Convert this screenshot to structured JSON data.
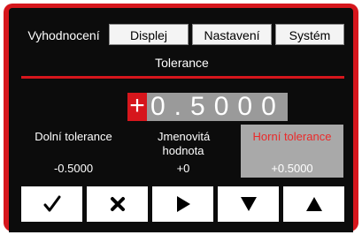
{
  "tabs": [
    {
      "label": "Vyhodnocení",
      "active": true
    },
    {
      "label": "Displej",
      "active": false
    },
    {
      "label": "Nastavení",
      "active": false
    },
    {
      "label": "Systém",
      "active": false
    }
  ],
  "section_title": "Tolerance",
  "entry": {
    "sign": "+",
    "digits": "0.5000"
  },
  "columns": {
    "lower": {
      "label": "Dolní tolerance",
      "value": "-0.5000"
    },
    "nominal": {
      "label": "Jmenovitá hodnota",
      "value": "+0"
    },
    "upper": {
      "label": "Horní tolerance",
      "value": "+0.5000"
    }
  },
  "buttons": [
    {
      "icon": "check-icon"
    },
    {
      "icon": "close-icon"
    },
    {
      "icon": "arrow-right-icon"
    },
    {
      "icon": "arrow-down-icon"
    },
    {
      "icon": "arrow-up-icon"
    }
  ],
  "colors": {
    "accent": "#d6161c",
    "screen": "#0c0c0c",
    "highlight": "#a9a9a9"
  }
}
